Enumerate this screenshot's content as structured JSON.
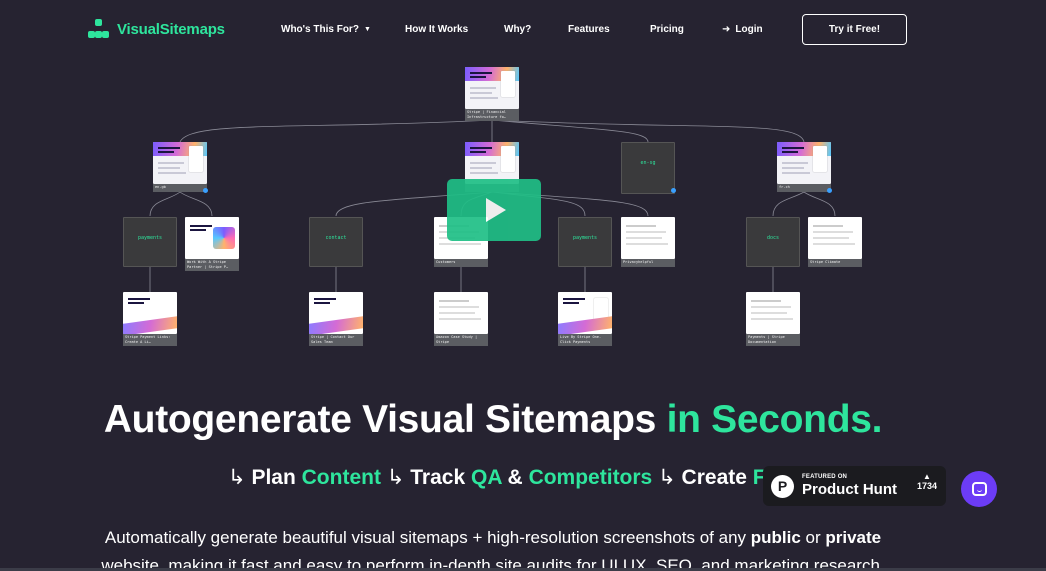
{
  "brand": {
    "name": "VisualSitemaps",
    "accent": "#2ee59d",
    "background": "#262331"
  },
  "nav": {
    "items": [
      {
        "label": "Who's This For?",
        "dropdown": true
      },
      {
        "label": "How It Works"
      },
      {
        "label": "Why?"
      },
      {
        "label": "Features"
      },
      {
        "label": "Pricing"
      }
    ],
    "login": "Login",
    "cta": "Try it Free!"
  },
  "sitemap": {
    "root_caption": "Stripe | Financial Infrastructure fo…",
    "level1": [
      {
        "caption": "en-gb"
      },
      {
        "caption": ""
      },
      {
        "caption": "en-sg",
        "dark": true
      },
      {
        "caption": "fr-ch"
      }
    ],
    "level2": [
      {
        "label": "payments",
        "dark": true
      },
      {
        "caption": "Work With A Stripe Partner | Stripe P…"
      },
      {
        "label": "contact",
        "dark": true
      },
      {
        "caption": "Customers"
      },
      {
        "label": "payments",
        "dark": true
      },
      {
        "caption": "Privacyhelpful"
      },
      {
        "label": "docs",
        "dark": true
      },
      {
        "caption": "Stripe Climate"
      }
    ],
    "level3": [
      {
        "caption": "Stripe Payment Links: Create A Li…"
      },
      {
        "caption": "Stripe | Contact Our Sales Team"
      },
      {
        "caption": "Amazon Case Study | Stripe"
      },
      {
        "caption": "Live By Stripe One-Click Payments"
      },
      {
        "caption": "Payments | Stripe Documentation"
      }
    ],
    "play_icon": "play-icon"
  },
  "hero": {
    "headline_white": "Autogenerate Visual Sitemaps ",
    "headline_green": "in Seconds.",
    "sub": {
      "arrow": "↳",
      "plan": "Plan ",
      "content": "Content",
      "track": "Track ",
      "qa": "QA",
      "amp": " & ",
      "competitors": "Competitors",
      "create": "Create ",
      "flows": "Flows"
    },
    "desc_line1_a": "Automatically generate beautiful visual sitemaps + high-resolution screenshots of any ",
    "desc_public": "public",
    "desc_or": " or ",
    "desc_private": "private",
    "desc_line2": "website, making it fast and easy to perform in-depth site audits for UI UX, SEO, and marketing research."
  },
  "product_hunt": {
    "featured": "FEATURED ON",
    "name": "Product Hunt",
    "votes": "1734",
    "logo": "P"
  },
  "chat": {
    "icon": "chat-icon",
    "color": "#6c3cf6"
  }
}
